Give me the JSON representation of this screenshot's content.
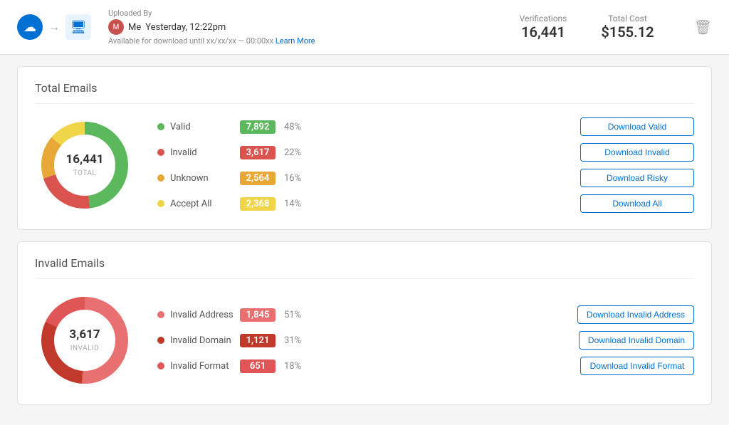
{
  "header": {
    "uploaded_by_label": "Uploaded By",
    "user": "Me",
    "timestamp": "Yesterday, 12:22pm",
    "availability": "Available for download until xx/xx/xx — 00:00xx",
    "learn_more": "Learn More",
    "verifications_label": "Verifications",
    "verifications_value": "16,441",
    "total_cost_label": "Total Cost",
    "total_cost_value": "$155.12",
    "delete_icon": "🗑"
  },
  "total_emails": {
    "title": "Total Emails",
    "donut_center_value": "16,441",
    "donut_center_label": "TOTAL",
    "rows": [
      {
        "id": "valid",
        "dot_class": "dot-valid",
        "label": "Valid",
        "count": "7,892",
        "badge_class": "color-valid",
        "percent": "48%",
        "btn": "Download Valid"
      },
      {
        "id": "invalid",
        "dot_class": "dot-invalid",
        "label": "Invalid",
        "count": "3,617",
        "badge_class": "color-invalid",
        "percent": "22%",
        "btn": "Download Invalid"
      },
      {
        "id": "unknown",
        "dot_class": "dot-unknown",
        "label": "Unknown",
        "count": "2,564",
        "badge_class": "color-unknown",
        "percent": "16%",
        "btn": "Download Risky"
      },
      {
        "id": "acceptall",
        "dot_class": "dot-acceptall",
        "label": "Accept All",
        "count": "2,368",
        "badge_class": "color-acceptall",
        "percent": "14%",
        "btn": "Download All"
      }
    ],
    "donut_segments": [
      {
        "color": "#5cb85c",
        "pct": 48
      },
      {
        "color": "#d9534f",
        "pct": 22
      },
      {
        "color": "#e8a838",
        "pct": 16
      },
      {
        "color": "#f0d44a",
        "pct": 14
      }
    ]
  },
  "invalid_emails": {
    "title": "Invalid Emails",
    "donut_center_value": "3,617",
    "donut_center_label": "INVALID",
    "rows": [
      {
        "id": "inv-address",
        "dot_class": "dot-inv-address",
        "label": "Invalid Address",
        "count": "1,845",
        "badge_class": "color-invalid-address",
        "percent": "51%",
        "btn": "Download Invalid Address"
      },
      {
        "id": "inv-domain",
        "dot_class": "dot-inv-domain",
        "label": "Invalid Domain",
        "count": "1,121",
        "badge_class": "color-invalid-domain",
        "percent": "31%",
        "btn": "Download Invalid Domain"
      },
      {
        "id": "inv-format",
        "dot_class": "dot-inv-format",
        "label": "Invalid Format",
        "count": "651",
        "badge_class": "color-invalid-format",
        "percent": "18%",
        "btn": "Download Invalid Format"
      }
    ],
    "donut_segments": [
      {
        "color": "#e87070",
        "pct": 51
      },
      {
        "color": "#c0392b",
        "pct": 31
      },
      {
        "color": "#e05555",
        "pct": 18
      }
    ]
  }
}
